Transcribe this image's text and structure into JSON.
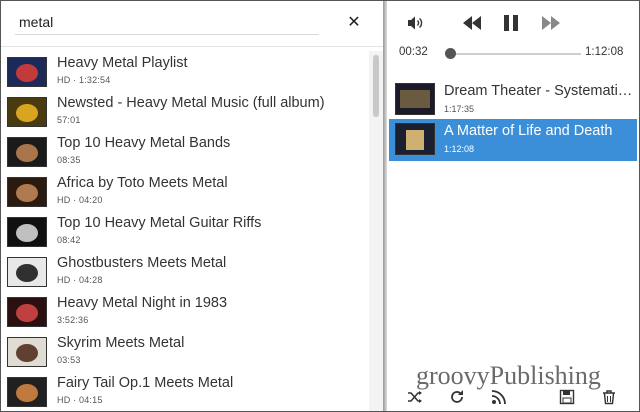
{
  "search": {
    "value": "metal",
    "clear_icon": "close-icon"
  },
  "results": [
    {
      "title": "Heavy Metal Playlist",
      "meta": "HD · 1:32:54",
      "thumb": [
        "#1c2a5a",
        "#c23a3a"
      ]
    },
    {
      "title": "Newsted - Heavy Metal Music (full album)",
      "meta": "57:01",
      "thumb": [
        "#4a3a10",
        "#d9a520"
      ]
    },
    {
      "title": "Top 10 Heavy Metal Bands",
      "meta": "08:35",
      "thumb": [
        "#1a1a1a",
        "#a8764a"
      ]
    },
    {
      "title": "Africa by Toto Meets Metal",
      "meta": "HD · 04:20",
      "thumb": [
        "#2a1a10",
        "#b07a50"
      ]
    },
    {
      "title": "Top 10 Heavy Metal Guitar Riffs",
      "meta": "08:42",
      "thumb": [
        "#101010",
        "#c0c0c0"
      ]
    },
    {
      "title": "Ghostbusters Meets Metal",
      "meta": "HD · 04:28",
      "thumb": [
        "#e8e8e8",
        "#303030"
      ]
    },
    {
      "title": "Heavy Metal Night in 1983",
      "meta": "3:52:36",
      "thumb": [
        "#2a1010",
        "#c04040"
      ]
    },
    {
      "title": "Skyrim Meets Metal",
      "meta": "03:53",
      "thumb": [
        "#e0dcd4",
        "#604030"
      ]
    },
    {
      "title": "Fairy Tail Op.1 Meets Metal",
      "meta": "HD · 04:15",
      "thumb": [
        "#202020",
        "#c07a40"
      ]
    }
  ],
  "player": {
    "elapsed": "00:32",
    "total": "1:12:08",
    "progress_fraction": 0.0074,
    "icons": [
      "volume-icon",
      "previous-icon",
      "pause-icon",
      "next-icon"
    ]
  },
  "queue": [
    {
      "title": "Dream Theater - Systematic Chaos",
      "duration": "1:17:35",
      "active": false,
      "thumb": [
        "#1a1a2a",
        "#6a5a40"
      ]
    },
    {
      "title": "A Matter of Life and Death",
      "duration": "1:12:08",
      "active": true,
      "thumb": [
        "#1a2030",
        "#d0b070"
      ]
    }
  ],
  "bottom_icons": [
    "shuffle-icon",
    "repeat-icon",
    "rss-icon",
    "save-icon",
    "trash-icon"
  ],
  "watermark": "groovyPublishing",
  "colors": {
    "accent": "#3b8fd9",
    "text": "#333333"
  }
}
